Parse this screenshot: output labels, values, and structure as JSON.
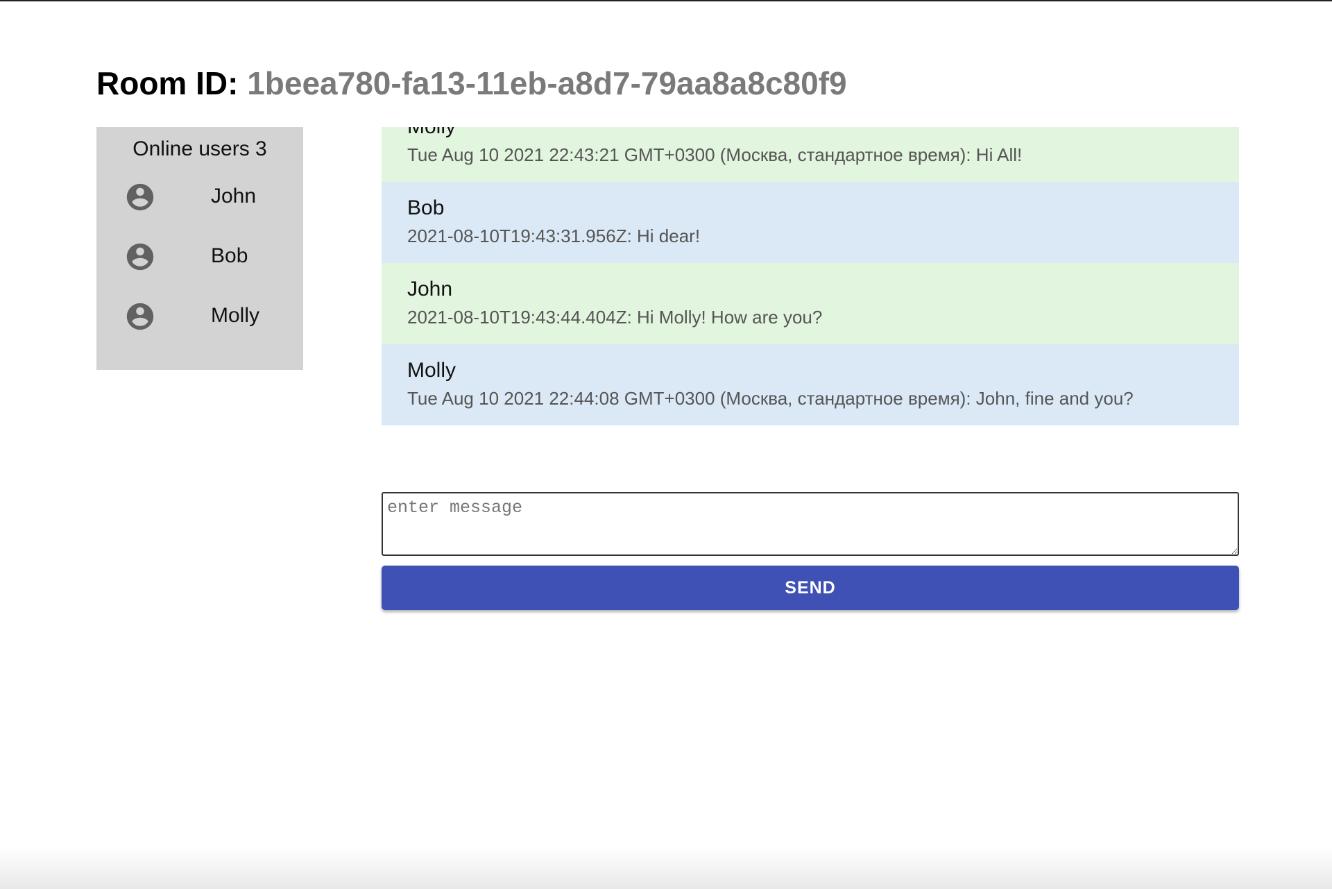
{
  "header": {
    "room_label": "Room ID:",
    "room_id": "1beea780-fa13-11eb-a8d7-79aa8a8c80f9"
  },
  "users_panel": {
    "title": "Online users 3",
    "icon": "account-circle-icon",
    "users": [
      {
        "name": "John"
      },
      {
        "name": "Bob"
      },
      {
        "name": "Molly"
      }
    ]
  },
  "messages": [
    {
      "author": "Molly",
      "text": "Tue Aug 10 2021 22:43:21 GMT+0300 (Москва, стандартное время): Hi All!",
      "color": "#e2f5de"
    },
    {
      "author": "Bob",
      "text": "2021-08-10T19:43:31.956Z: Hi dear!",
      "color": "#dbe9f6"
    },
    {
      "author": "John",
      "text": "2021-08-10T19:43:44.404Z: Hi Molly! How are you?",
      "color": "#e2f5de"
    },
    {
      "author": "Molly",
      "text": "Tue Aug 10 2021 22:44:08 GMT+0300 (Москва, стандартное время): John, fine and you?",
      "color": "#dbe9f6"
    }
  ],
  "composer": {
    "placeholder": "enter message",
    "value": ""
  },
  "send_button": {
    "label": "SEND",
    "color": "#3f51b5"
  }
}
